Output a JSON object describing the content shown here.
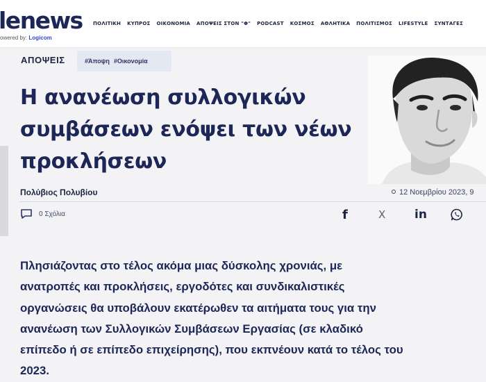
{
  "header": {
    "logo": "lenews",
    "powered_prefix": "owered by: ",
    "powered_brand": "Logicom",
    "nav": [
      "ΠΟΛΙΤΙΚΗ",
      "ΚΥΠΡΟΣ",
      "ΟΙΚΟΝΟΜΙΑ",
      "ΑΠΟΨΕΙΣ ΣΤΟΝ \"Φ\"",
      "PODCAST",
      "ΚΟΣΜΟΣ",
      "ΑΘΛΗΤΙΚΑ",
      "ΠΟΛΙΤΙΣΜΟΣ",
      "LIFESTYLE",
      "ΣΥΝΤΑΓΕΣ"
    ]
  },
  "article": {
    "section": "ΑΠΟΨΕΙΣ",
    "tags": [
      "#Άποψη",
      "#Οικονομία"
    ],
    "title_lines": [
      "Η ανανέωση συλλογικών",
      "συμβάσεων ενόψει των νέων",
      "προκλήσεων"
    ],
    "author": "Πολύβιος Πολυβίου",
    "date": "12 Νοεμβρίου 2023, 9",
    "comments": "0 Σχόλια",
    "share_icons": [
      "facebook-icon",
      "x-icon",
      "linkedin-icon",
      "whatsapp-icon"
    ],
    "share_glyphs": [
      "f",
      "X",
      "in"
    ],
    "lede_lines": [
      "Πλησιάζοντας στο τέλος ακόμα μιας δύσκολης χρονιάς, με",
      "ανατροπές και προκλήσεις, εργοδότες και συνδικαλιστικές",
      "οργανώσεις θα υποβάλουν εκατέρωθεν τα αιτήματα τους για την",
      "ανανέωση των Συλλογικών Συμβάσεων Εργασίας (σε κλαδικό",
      "επίπεδο ή σε επίπεδο επιχείρησης), που εκπνέουν κατά το τέλος του",
      "2023."
    ]
  },
  "colors": {
    "navy": "#1c2657",
    "tag_bg": "#e4e8f3",
    "brand_blue": "#2f49c9"
  }
}
